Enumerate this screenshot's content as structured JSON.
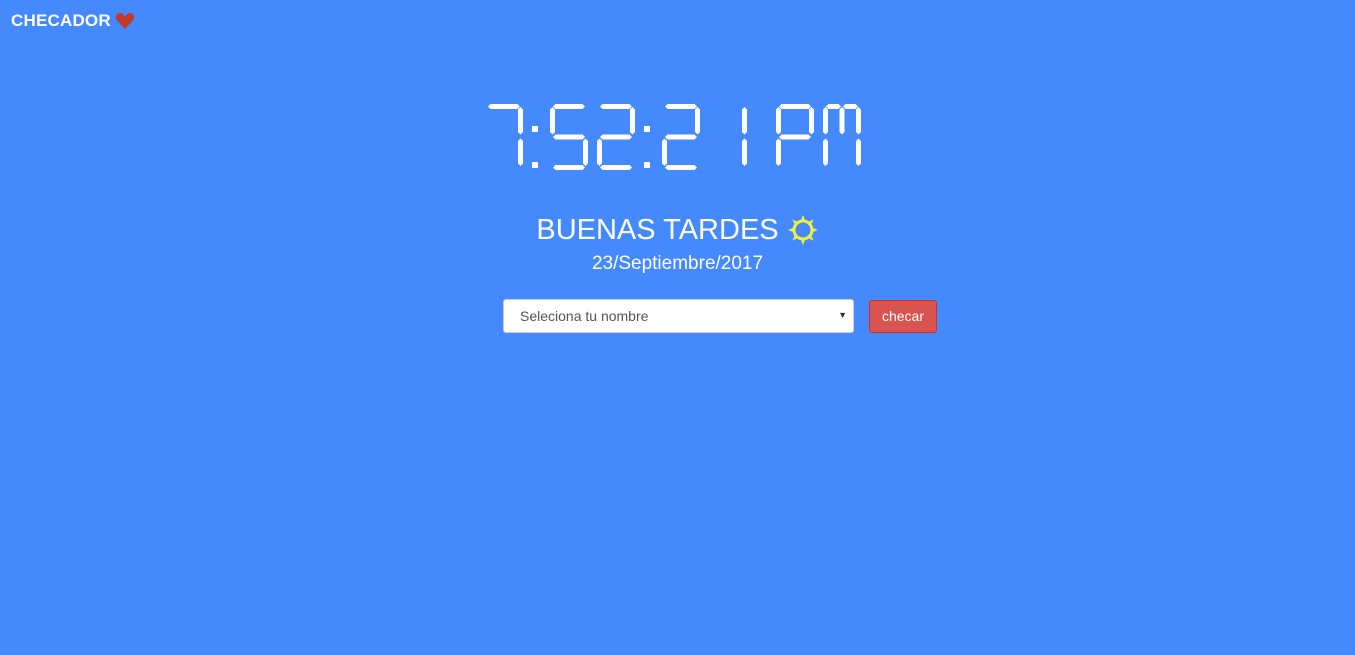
{
  "brand": {
    "title": "CHECADOR",
    "icon": "heart-icon",
    "icon_color": "#c0392b"
  },
  "clock": {
    "time": "7:52:21 PM"
  },
  "greeting": {
    "text": "BUENAS TARDES",
    "icon": "sun-icon",
    "icon_color": "#f2ec3d"
  },
  "date": {
    "text": "23/Septiembre/2017"
  },
  "form": {
    "select_value": "Seleciona tu nombre",
    "button_label": "checar",
    "button_color": "#d9534f"
  },
  "colors": {
    "background": "#4589ff",
    "text": "#ffffff"
  }
}
